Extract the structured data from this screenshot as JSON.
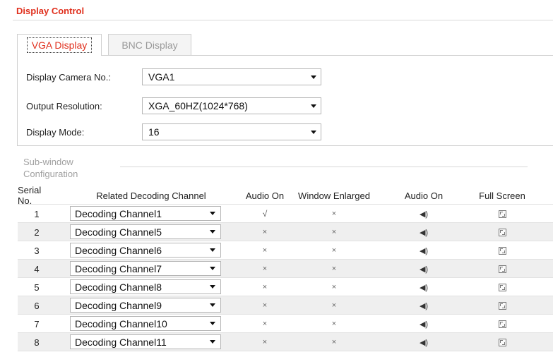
{
  "panel": {
    "title": "Display Control"
  },
  "tabs": [
    {
      "label": "VGA Display",
      "active": true
    },
    {
      "label": "BNC Display",
      "active": false
    }
  ],
  "settings": {
    "camera": {
      "label": "Display Camera No.:",
      "value": "VGA1"
    },
    "resolution": {
      "label": "Output Resolution:",
      "value": "XGA_60HZ(1024*768)"
    },
    "mode": {
      "label": "Display Mode:",
      "value": "16"
    }
  },
  "subwindow": {
    "legend": "Sub-window Configuration"
  },
  "table": {
    "headers": {
      "serial": "Serial No.",
      "channel": "Related Decoding Channel",
      "audio_on": "Audio On",
      "window_enlarged": "Window Enlarged",
      "audio_on_2": "Audio On",
      "full_screen": "Full Screen"
    },
    "rows": [
      {
        "serial": "1",
        "channel": "Decoding Channel1",
        "audio_on": "√",
        "enlarged": "×"
      },
      {
        "serial": "2",
        "channel": "Decoding Channel5",
        "audio_on": "×",
        "enlarged": "×"
      },
      {
        "serial": "3",
        "channel": "Decoding Channel6",
        "audio_on": "×",
        "enlarged": "×"
      },
      {
        "serial": "4",
        "channel": "Decoding Channel7",
        "audio_on": "×",
        "enlarged": "×"
      },
      {
        "serial": "5",
        "channel": "Decoding Channel8",
        "audio_on": "×",
        "enlarged": "×"
      },
      {
        "serial": "6",
        "channel": "Decoding Channel9",
        "audio_on": "×",
        "enlarged": "×"
      },
      {
        "serial": "7",
        "channel": "Decoding Channel10",
        "audio_on": "×",
        "enlarged": "×"
      },
      {
        "serial": "8",
        "channel": "Decoding Channel11",
        "audio_on": "×",
        "enlarged": "×"
      }
    ]
  },
  "icons": {
    "speaker": "speaker-icon",
    "full_screen": "full-screen-icon",
    "dropdown": "chevron-down-icon"
  },
  "colors": {
    "title": "#e0301e",
    "row_alt": "#efefef"
  }
}
